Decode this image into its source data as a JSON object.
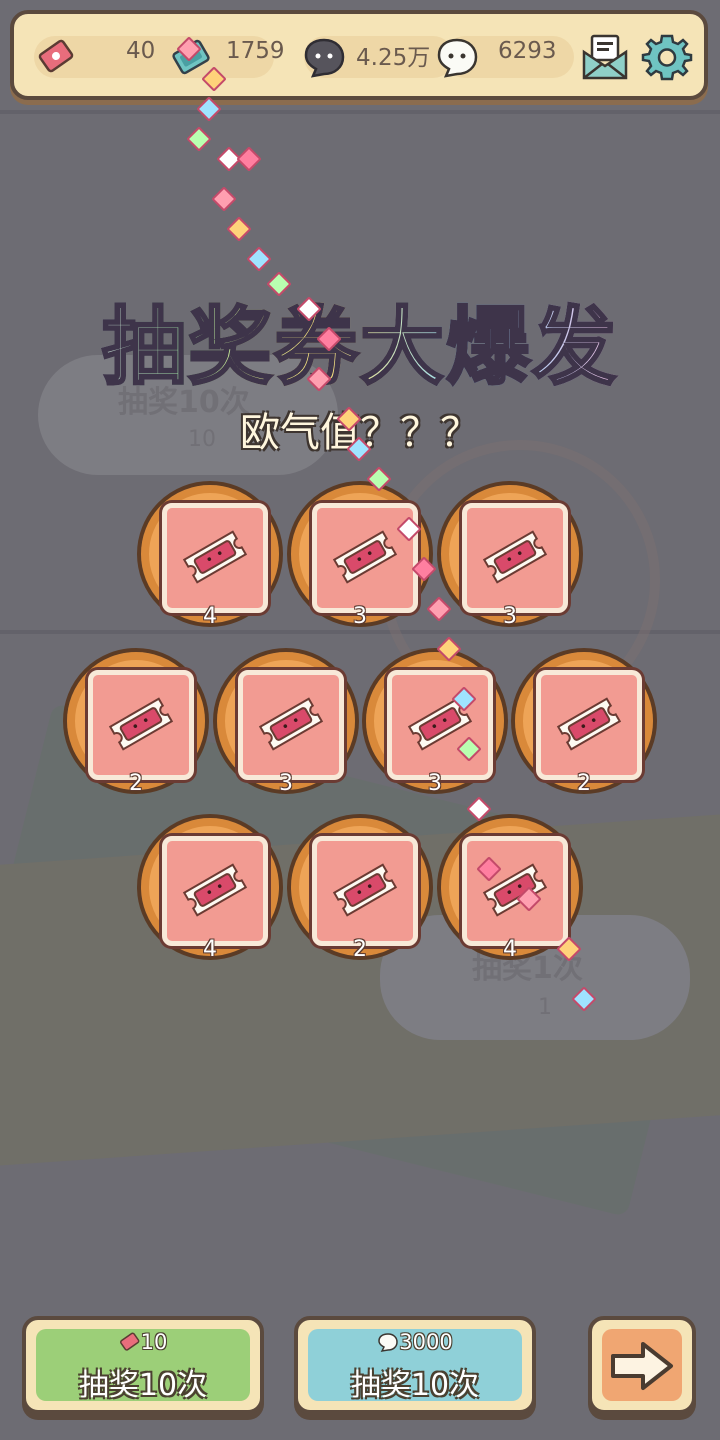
{
  "resources": [
    {
      "name": "ticket",
      "icon": "ticket-icon",
      "value": "40"
    },
    {
      "name": "gem-ticket",
      "icon": "blue-ticket-icon",
      "value": "1759"
    },
    {
      "name": "dark-bubble",
      "icon": "dark-bubble-icon",
      "value": "4.25万"
    },
    {
      "name": "light-bubble",
      "icon": "white-bubble-icon",
      "value": "6293"
    }
  ],
  "header_icons": [
    "mail-icon",
    "gear-icon"
  ],
  "background": {
    "left_panel_label": "抽奖10次",
    "left_panel_cost": "10",
    "right_panel_label": "抽奖1次",
    "right_panel_cost": "1"
  },
  "title": "抽奖券大爆发",
  "subtitle": "欧气值？？？",
  "prizes": [
    {
      "item": "ticket-icon",
      "count": "4"
    },
    {
      "item": "ticket-icon",
      "count": "3"
    },
    {
      "item": "ticket-icon",
      "count": "3"
    },
    {
      "item": "ticket-icon",
      "count": "2"
    },
    {
      "item": "ticket-icon",
      "count": "3"
    },
    {
      "item": "ticket-icon",
      "count": "3"
    },
    {
      "item": "ticket-icon",
      "count": "2"
    },
    {
      "item": "ticket-icon",
      "count": "4"
    },
    {
      "item": "ticket-icon",
      "count": "2"
    },
    {
      "item": "ticket-icon",
      "count": "4"
    }
  ],
  "buttons": {
    "ticket_draw": {
      "cost": "10",
      "cost_icon": "ticket-icon",
      "label": "抽奖10次"
    },
    "bubble_draw": {
      "cost": "3000",
      "cost_icon": "bubble-icon",
      "label": "抽奖10次"
    },
    "next": {
      "icon": "arrow-right-icon"
    }
  },
  "colors": {
    "green_button": "#9ccf78",
    "blue_button": "#8fd0d8",
    "orange_button": "#f0a672",
    "prize_ring": "#eea457",
    "prize_card": "#f29b92"
  }
}
